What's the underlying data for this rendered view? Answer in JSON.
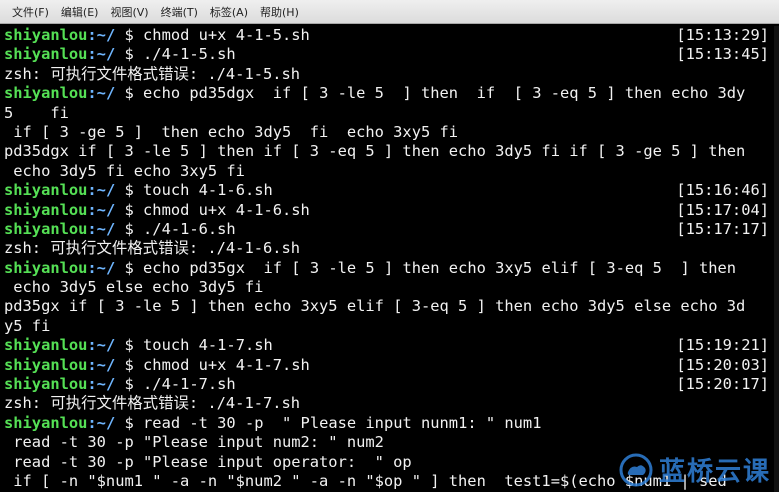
{
  "menu": [
    "文件(F)",
    "编辑(E)",
    "视图(V)",
    "终端(T)",
    "标签(A)",
    "帮助(H)"
  ],
  "prompt": {
    "user": "shiyanlou",
    "path": ":~/",
    "symbol": " $ "
  },
  "lines": [
    {
      "type": "prompt",
      "cmd": "chmod u+x 4-1-5.sh",
      "ts": "[15:13:29]"
    },
    {
      "type": "prompt",
      "cmd": "./4-1-5.sh",
      "ts": "[15:13:45]"
    },
    {
      "type": "out",
      "text": "zsh: 可执行文件格式错误: ./4-1-5.sh"
    },
    {
      "type": "prompt",
      "cmd": "echo pd35dgx  if [ 3 -le 5  ] then  if  [ 3 -eq 5 ] then echo 3dy"
    },
    {
      "type": "out",
      "text": "5    fi"
    },
    {
      "type": "out",
      "text": " if [ 3 -ge 5 ]  then echo 3dy5  fi  echo 3xy5 fi"
    },
    {
      "type": "out",
      "text": "pd35dgx if [ 3 -le 5 ] then if [ 3 -eq 5 ] then echo 3dy5 fi if [ 3 -ge 5 ] then"
    },
    {
      "type": "out",
      "text": " echo 3dy5 fi echo 3xy5 fi"
    },
    {
      "type": "prompt",
      "cmd": "touch 4-1-6.sh",
      "ts": "[15:16:46]"
    },
    {
      "type": "prompt",
      "cmd": "chmod u+x 4-1-6.sh",
      "ts": "[15:17:04]"
    },
    {
      "type": "prompt",
      "cmd": "./4-1-6.sh",
      "ts": "[15:17:17]"
    },
    {
      "type": "out",
      "text": "zsh: 可执行文件格式错误: ./4-1-6.sh"
    },
    {
      "type": "prompt",
      "cmd": "echo pd35gx  if [ 3 -le 5 ] then echo 3xy5 elif [ 3-eq 5  ] then"
    },
    {
      "type": "out",
      "text": " echo 3dy5 else echo 3dy5 fi"
    },
    {
      "type": "out",
      "text": "pd35gx if [ 3 -le 5 ] then echo 3xy5 elif [ 3-eq 5 ] then echo 3dy5 else echo 3d"
    },
    {
      "type": "out",
      "text": "y5 fi"
    },
    {
      "type": "prompt",
      "cmd": "touch 4-1-7.sh",
      "ts": "[15:19:21]"
    },
    {
      "type": "prompt",
      "cmd": "chmod u+x 4-1-7.sh",
      "ts": "[15:20:03]"
    },
    {
      "type": "prompt",
      "cmd": "./4-1-7.sh",
      "ts": "[15:20:17]"
    },
    {
      "type": "out",
      "text": "zsh: 可执行文件格式错误: ./4-1-7.sh"
    },
    {
      "type": "prompt",
      "cmd": "read -t 30 -p  \" Please input nunm1: \" num1"
    },
    {
      "type": "out",
      "text": " read -t 30 -p \"Please input num2: \" num2"
    },
    {
      "type": "out",
      "text": " read -t 30 -p \"Please input operator:  \" op"
    },
    {
      "type": "out",
      "text": " if [ -n \"$num1 \" -a -n \"$num2 \" -a -n \"$op \" ] then  test1=$(echo $num1 | sed"
    }
  ],
  "watermark": {
    "text": "蓝桥云课",
    "color": "#2f7fd6"
  },
  "colors": {
    "background": "#000000",
    "prompt_user": "#55e055",
    "prompt_path": "#6fb6ff",
    "text": "#f2f2f2"
  }
}
